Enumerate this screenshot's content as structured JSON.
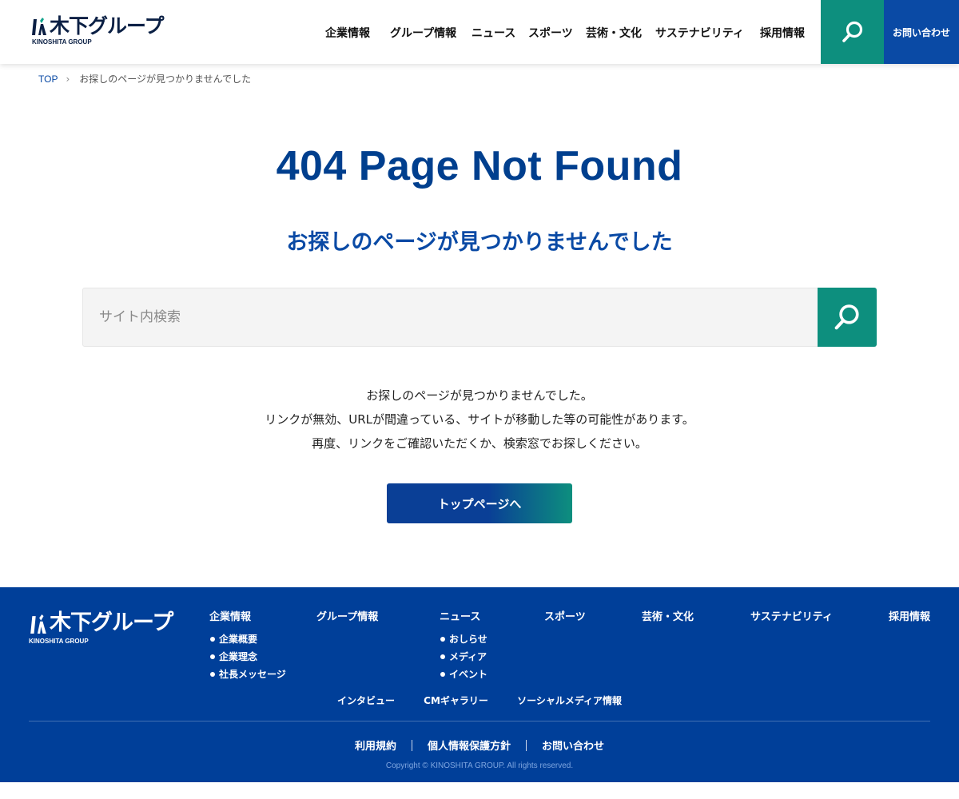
{
  "header": {
    "logo_text": "木下グループ",
    "logo_sub": "KINOSHITA GROUP",
    "nav": [
      "企業情報",
      "グループ情報",
      "ニュース",
      "スポーツ",
      "芸術・文化",
      "サステナビリティ",
      "採用情報"
    ],
    "contact_label": "お問い合わせ",
    "search_icon": "search-icon",
    "colors": {
      "search_bg": "#0d8f7e",
      "contact_bg": "#0a4aa5"
    }
  },
  "breadcrumb": {
    "top": "TOP",
    "separator": "›",
    "current": "お探しのページが見つかりませんでした"
  },
  "main": {
    "title": "404 Page Not Found",
    "subtitle": "お探しのページが見つかりませんでした",
    "search_placeholder": "サイト内検索",
    "message_lines": [
      "お探しのページが見つかりませんでした。",
      "リンクが無効、URLが間違っている、サイトが移動した等の可能性があります。",
      "再度、リンクをご確認いただくか、検索窓でお探しください。"
    ],
    "top_button": "トップページへ",
    "colors": {
      "title": "#003f8e",
      "button_start": "#0a3f96",
      "button_end": "#0d8f7e"
    }
  },
  "footer": {
    "logo_text": "木下グループ",
    "logo_sub": "KINOSHITA GROUP",
    "columns": [
      {
        "heading": "企業情報",
        "items": [
          "企業概要",
          "企業理念",
          "社長メッセージ"
        ]
      },
      {
        "heading": "グループ情報",
        "items": []
      },
      {
        "heading": "ニュース",
        "items": [
          "おしらせ",
          "メディア",
          "イベント"
        ]
      },
      {
        "heading": "スポーツ",
        "items": []
      },
      {
        "heading": "芸術・文化",
        "items": []
      },
      {
        "heading": "サステナビリティ",
        "items": []
      },
      {
        "heading": "採用情報",
        "items": []
      }
    ],
    "secondary_links": [
      "インタビュー",
      "CMギャラリー",
      "ソーシャルメディア情報"
    ],
    "legal_links": [
      "利用規約",
      "個人情報保護方針",
      "お問い合わせ"
    ],
    "copyright": "Copyright © KINOSHITA GROUP. All rights reserved.",
    "colors": {
      "bg": "#003f99"
    }
  }
}
